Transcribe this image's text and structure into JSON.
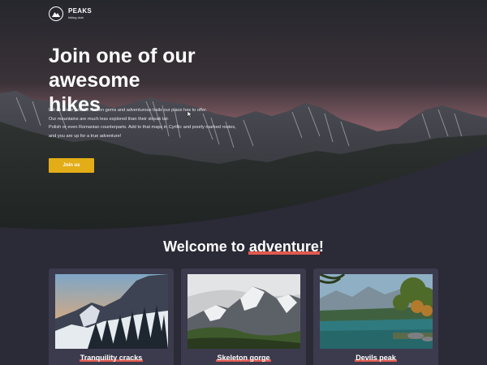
{
  "brand": {
    "name": "PEAKS",
    "subtitle": "hiking club",
    "logo_icon": "mountain-logo-icon"
  },
  "hero": {
    "title_line1": "Join one of our",
    "title_highlight": "awesome",
    "title_line2_rest": " hikes",
    "paragraph": [
      "Let us show you the hidden gems and adventurous trails our place has to offer.",
      "Our mountains are much less explored than their slovak tat-",
      "Polish or even Romanian counterparts. Add to that maps in Cyrillic and poorly marked routes,",
      "and you are up for a true adventure!"
    ],
    "button_label": "Join us"
  },
  "welcome": {
    "prefix": "Welcome to ",
    "highlight": "adventure",
    "suffix": "!"
  },
  "cards": [
    {
      "title": "Tranquility cracks",
      "image_icon": "snowy-forest-mountain-photo"
    },
    {
      "title": "Skeleton gorge",
      "image_icon": "cloudy-peaks-photo"
    },
    {
      "title": "Devils peak",
      "image_icon": "lake-forest-photo"
    }
  ],
  "colors": {
    "accent": "#e05a4f",
    "button": "#e3ad17",
    "background": "#2b2a37",
    "card": "#3c3b4d"
  }
}
